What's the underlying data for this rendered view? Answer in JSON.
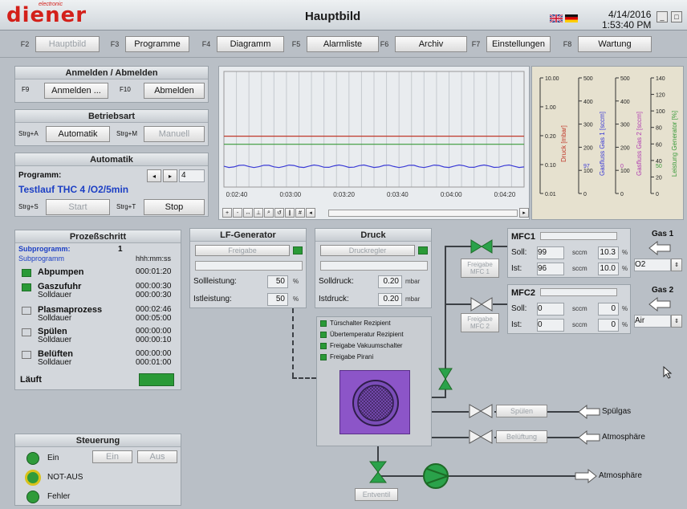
{
  "app": {
    "brand": "diener",
    "brand_sub": "electronic",
    "title": "Hauptbild",
    "date": "4/14/2016",
    "time": "1:53:40 PM"
  },
  "fkeys": [
    {
      "key": "F2",
      "label": "Hauptbild",
      "disabled": true
    },
    {
      "key": "F3",
      "label": "Programme"
    },
    {
      "key": "F4",
      "label": "Diagramm"
    },
    {
      "key": "F5",
      "label": "Alarmliste"
    },
    {
      "key": "F6",
      "label": "Archiv"
    },
    {
      "key": "F7",
      "label": "Einstellungen"
    },
    {
      "key": "F8",
      "label": "Wartung"
    }
  ],
  "login": {
    "title": "Anmelden / Abmelden",
    "k1": "F9",
    "b1": "Anmelden ...",
    "k2": "F10",
    "b2": "Abmelden"
  },
  "betriebsart": {
    "title": "Betriebsart",
    "k1": "Strg+A",
    "b1": "Automatik",
    "k2": "Strg+M",
    "b2": "Manuell"
  },
  "automatik": {
    "title": "Automatik",
    "programm_label": "Programm:",
    "program_no": "4",
    "program_name": "Testlauf THC 4 /O2/5min",
    "k1": "Strg+S",
    "b1": "Start",
    "k2": "Strg+T",
    "b2": "Stop"
  },
  "prozess": {
    "title": "Prozeßschritt",
    "subprog_label": "Subprogramm:",
    "subprog_value": "1",
    "subprog_head": "Subprogramm",
    "time_head": "hhh:mm:ss",
    "steps": [
      {
        "name": "Abpumpen",
        "active": true,
        "time": "000:01:20"
      },
      {
        "name": "Gaszufuhr",
        "active": true,
        "time": "000:00:30",
        "sub": "Solldauer",
        "sub_time": "000:00:30"
      },
      {
        "name": "Plasmaprozess",
        "active": false,
        "time": "000:02:46",
        "sub": "Solldauer",
        "sub_time": "000:05:00"
      },
      {
        "name": "Spülen",
        "active": false,
        "time": "000:00:00",
        "sub": "Solldauer",
        "sub_time": "000:00:10"
      },
      {
        "name": "Belüften",
        "active": false,
        "time": "000:00:00",
        "sub": "Solldauer",
        "sub_time": "000:01:00"
      }
    ],
    "laeuft": "Läuft"
  },
  "steuerung": {
    "title": "Steuerung",
    "ein": "Ein",
    "ein_btn": "Ein",
    "aus_btn": "Aus",
    "notaus": "NOT-AUS",
    "fehler": "Fehler"
  },
  "lf": {
    "title": "LF-Generator",
    "freigabe": "Freigabe",
    "soll_label": "Sollleistung:",
    "soll": "50",
    "ist_label": "Istleistung:",
    "ist": "50",
    "unit": "%"
  },
  "druck": {
    "title": "Druck",
    "regler": "Druckregler",
    "soll_label": "Solldruck:",
    "soll": "0.20",
    "ist_label": "Istdruck:",
    "ist": "0.20",
    "unit": "mbar"
  },
  "chart_data": {
    "type": "line",
    "x": [
      "0:02:40",
      "0:03:00",
      "0:03:20",
      "0:03:40",
      "0:04:00",
      "0:04:20"
    ],
    "axes": [
      {
        "label": "Druck [mbar]",
        "color": "#c0392b",
        "ticks": [
          "10.00",
          "1.00",
          "0.20",
          "0.10",
          "0.01"
        ]
      },
      {
        "label": "Gasfluss Gas 1 [sccm]",
        "color": "#3b3bd6",
        "ticks": [
          "500",
          "400",
          "300",
          "200",
          "100",
          "0"
        ],
        "marker": "97"
      },
      {
        "label": "Gasfluss Gas 2 [sccm]",
        "color": "#b03cb0",
        "ticks": [
          "500",
          "400",
          "300",
          "200",
          "100",
          "0"
        ],
        "marker": "0"
      },
      {
        "label": "Leistung Generator [%]",
        "color": "#3a9a3a",
        "ticks": [
          "140",
          "120",
          "100",
          "80",
          "60",
          "40",
          "20",
          "0"
        ],
        "marker": "50"
      }
    ],
    "series": [
      {
        "name": "Druck",
        "color": "#c0392b",
        "level": 0.2
      },
      {
        "name": "Leistung Generator",
        "color": "#3a9a3a",
        "level": 50
      },
      {
        "name": "Gas 1",
        "color": "#3b3bd6",
        "level": 97
      }
    ]
  },
  "mfc1": {
    "title": "MFC1",
    "soll_label": "Soll:",
    "soll": "99",
    "soll_pct": "10.3",
    "ist_label": "Ist:",
    "ist": "96",
    "ist_pct": "10.0",
    "unit": "sccm",
    "pct": "%",
    "gas_label": "Gas 1",
    "gas": "O2",
    "freigabe": "Freigabe MFC 1"
  },
  "mfc2": {
    "title": "MFC2",
    "soll_label": "Soll:",
    "soll": "0",
    "soll_pct": "0",
    "ist_label": "Ist:",
    "ist": "0",
    "ist_pct": "0",
    "unit": "sccm",
    "pct": "%",
    "gas_label": "Gas 2",
    "gas": "Air",
    "freigabe": "Freigabe MFC 2"
  },
  "chamber": {
    "status": [
      "Türschalter Rezipient",
      "Übertemperatur Rezipient",
      "Freigabe Vakuumschalter",
      "Freigabe Pirani"
    ]
  },
  "lines": {
    "spuelen": "Spülen",
    "spuelgas": "Spülgas",
    "belueftung": "Belüftung",
    "atmos1": "Atmosphäre",
    "atmos2": "Atmosphäre",
    "ventil": "Entventil"
  }
}
